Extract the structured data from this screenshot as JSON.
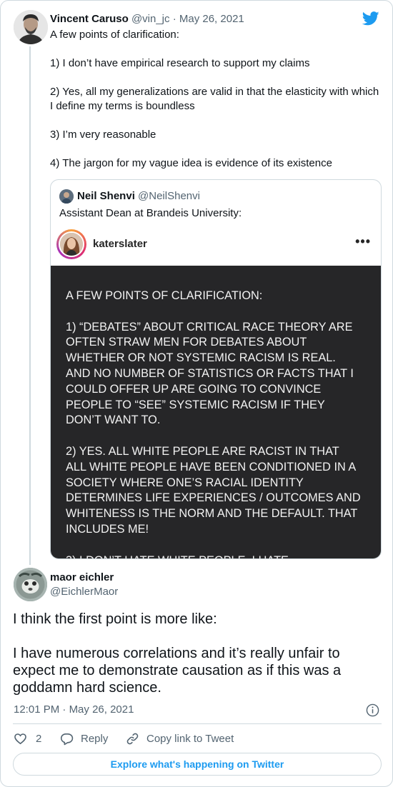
{
  "parent_tweet": {
    "author_name": "Vincent Caruso",
    "author_handle": "@vin_jc",
    "separator": "·",
    "date": "May 26, 2021",
    "paragraphs": [
      "A few points of clarification:",
      "1) I don’t have empirical research to support my claims",
      "2) Yes, all my generalizations are valid in that the elasticity with which I define my terms is boundless",
      "3) I’m very reasonable",
      "4) The jargon for my vague idea is evidence of its existence"
    ]
  },
  "quoted_tweet": {
    "author_name": "Neil Shenvi",
    "author_handle": "@NeilShenvi",
    "text": "Assistant Dean at Brandeis University:",
    "instagram": {
      "username": "katerslater",
      "more_label": "•••",
      "image_paragraphs": [
        "A FEW POINTS OF CLARIFICATION:",
        "1) “DEBATES” ABOUT CRITICAL RACE THEORY ARE OFTEN STRAW MEN FOR DEBATES ABOUT WHETHER OR NOT SYSTEMIC RACISM IS REAL. AND NO NUMBER OF STATISTICS OR FACTS THAT I COULD OFFER UP ARE GOING TO CONVINCE PEOPLE TO “SEE” SYSTEMIC RACISM IF THEY DON’T WANT TO.",
        "2) YES. ALL WHITE PEOPLE ARE RACIST IN THAT ALL WHITE PEOPLE HAVE BEEN CONDITIONED IN A SOCIETY WHERE ONE’S RACIAL IDENTITY DETERMINES LIFE EXPERIENCES / OUTCOMES AND WHITENESS IS THE NORM AND THE DEFAULT. THAT INCLUDES ME!",
        "3) I DON’T HATE WHITE PEOPLE. I HATE"
      ]
    }
  },
  "reply_tweet": {
    "author_name": "maor eichler",
    "author_handle": "@EichlerMaor",
    "paragraphs": [
      "I think the first point is more like:",
      "I have numerous correlations and it’s really unfair to expect me to demonstrate causation as if this was a goddamn hard science."
    ],
    "time": "12:01 PM",
    "separator": "·",
    "date": "May 26, 2021"
  },
  "actions": {
    "like_count": "2",
    "reply_label": "Reply",
    "copy_label": "Copy link to Tweet"
  },
  "explore_label": "Explore what's happening on Twitter",
  "colors": {
    "accent": "#1d9bf0",
    "text": "#0f1419",
    "secondary": "#536471",
    "border": "#cfd9de",
    "ig_background": "#262628"
  },
  "icons": {
    "brand": "twitter-bird-icon",
    "like": "heart-icon",
    "reply": "speech-bubble-icon",
    "copy": "link-icon",
    "info": "info-icon"
  }
}
